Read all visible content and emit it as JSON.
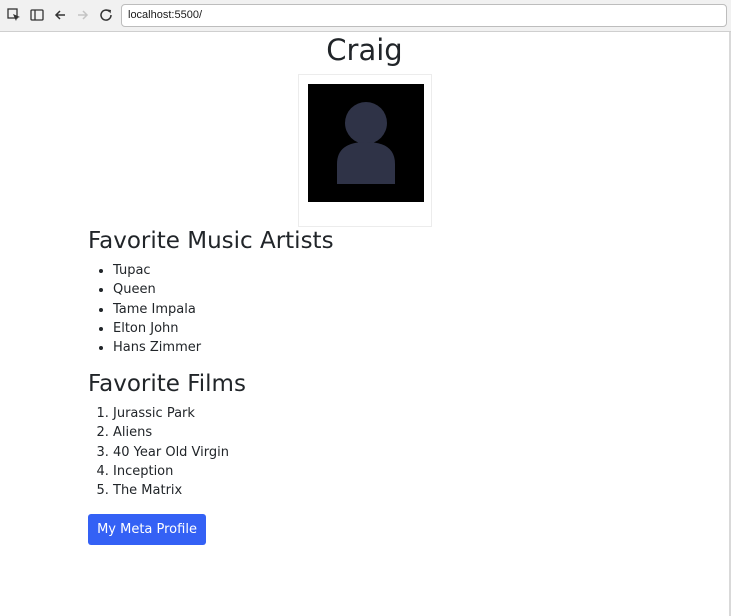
{
  "browser": {
    "url": "localhost:5500/",
    "icons": [
      "inspect-icon",
      "device-toggle-icon",
      "back-icon",
      "forward-icon",
      "reload-icon"
    ]
  },
  "profile": {
    "name": "Craig"
  },
  "music": {
    "heading": "Favorite Music Artists",
    "items": [
      "Tupac",
      "Queen",
      "Tame Impala",
      "Elton John",
      "Hans Zimmer"
    ]
  },
  "films": {
    "heading": "Favorite Films",
    "items": [
      "Jurassic Park",
      "Aliens",
      "40 Year Old Virgin",
      "Inception",
      "The Matrix"
    ]
  },
  "button": {
    "label": "My Meta Profile"
  },
  "colors": {
    "button_bg": "#3461f5",
    "avatar_bg": "#000000",
    "avatar_figure": "#2f3347"
  }
}
